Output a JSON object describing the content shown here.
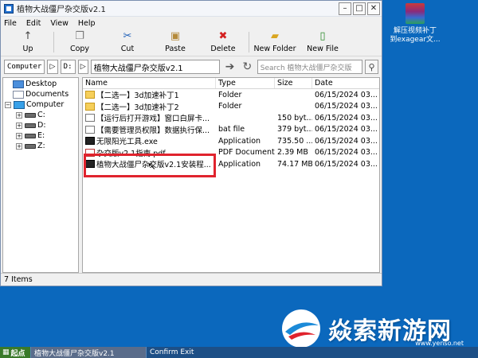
{
  "window": {
    "title": "植物大战僵尸杂交版v2.1",
    "controls": {
      "minimize": "–",
      "maximize": "□",
      "close": "✕"
    }
  },
  "menu": [
    "File",
    "Edit",
    "View",
    "Help"
  ],
  "toolbar": {
    "up": "Up",
    "copy": "Copy",
    "cut": "Cut",
    "paste": "Paste",
    "delete": "Delete",
    "new_folder": "New Folder",
    "new_file": "New File"
  },
  "address": {
    "computer": "Computer",
    "drive": "D:",
    "folder": "植物大战僵尸杂交版v2.1",
    "search_placeholder": "Search 植物大战僵尸杂交版"
  },
  "tree": [
    "Desktop",
    "Documents",
    "Computer",
    "C:",
    "D:",
    "E:",
    "Z:"
  ],
  "columns": {
    "name": "Name",
    "type": "Type",
    "size": "Size",
    "date": "Date"
  },
  "files": [
    {
      "name": "【二选一】3d加速补丁1",
      "type": "Folder",
      "size": "",
      "date": "06/15/2024 03...",
      "icon": "folder"
    },
    {
      "name": "【二选一】3d加速补丁2",
      "type": "Folder",
      "size": "",
      "date": "06/15/2024 03...",
      "icon": "folder"
    },
    {
      "name": "【运行后打开游戏】窗口白屏卡...",
      "type": "",
      "size": "150 byt...",
      "date": "06/15/2024 03...",
      "icon": "file"
    },
    {
      "name": "【需要管理员权限】数据执行保...",
      "type": "bat file",
      "size": "379 byt...",
      "date": "06/15/2024 03...",
      "icon": "file"
    },
    {
      "name": "无限阳光工具.exe",
      "type": "Application",
      "size": "735.50 ...",
      "date": "06/15/2024 03...",
      "icon": "exe"
    },
    {
      "name": "杂交版v2.1指南.pdf",
      "type": "PDF Document",
      "size": "2.39 MB",
      "date": "06/15/2024 03...",
      "icon": "pdf"
    },
    {
      "name": "植物大战僵尸杂交版v2.1安装程...",
      "type": "Application",
      "size": "74.17 MB",
      "date": "06/15/2024 03...",
      "icon": "exe"
    }
  ],
  "status": "7 Items",
  "desktop_icon": {
    "line1": "解压视频补丁",
    "line2": "到exagear文..."
  },
  "watermark": {
    "text": "焱索新游网",
    "url": "www.yenso.net"
  },
  "taskbar": {
    "start": "起点",
    "task1": "植物大战僵尸杂交版v2.1",
    "task2": "Confirm Exit"
  }
}
